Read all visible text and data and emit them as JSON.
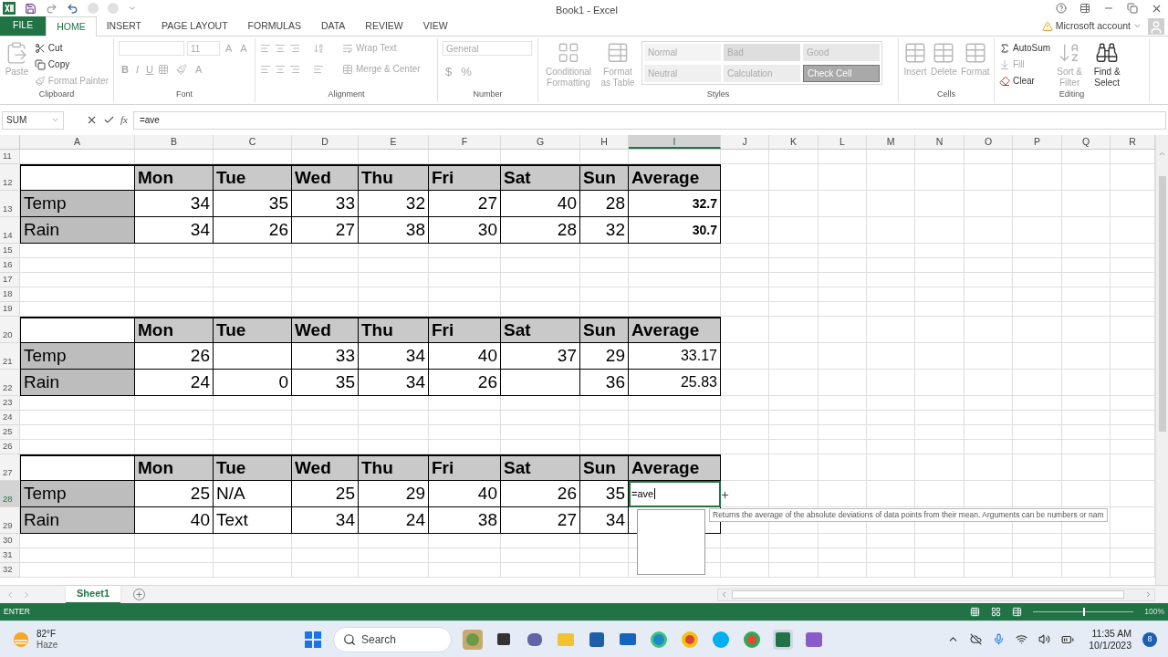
{
  "window": {
    "title": "Book1 - Excel"
  },
  "ribbon": {
    "tabs": [
      {
        "label": "FILE",
        "kind": "file",
        "selected": false
      },
      {
        "label": "HOME",
        "kind": "tab",
        "selected": true
      },
      {
        "label": "INSERT",
        "kind": "tab",
        "selected": false
      },
      {
        "label": "PAGE LAYOUT",
        "kind": "tab",
        "selected": false
      },
      {
        "label": "FORMULAS",
        "kind": "tab",
        "selected": false
      },
      {
        "label": "DATA",
        "kind": "tab",
        "selected": false
      },
      {
        "label": "REVIEW",
        "kind": "tab",
        "selected": false
      },
      {
        "label": "VIEW",
        "kind": "tab",
        "selected": false
      }
    ],
    "account": "Microsoft account",
    "groups": [
      {
        "kind": "clipboard",
        "name": "Clipboard",
        "buttons": [
          {
            "label": "Paste",
            "disabled": true
          },
          {
            "label": "Cut",
            "disabled": false
          },
          {
            "label": "Copy",
            "disabled": false
          },
          {
            "label": "Format Painter",
            "disabled": true
          }
        ]
      },
      {
        "kind": "font",
        "name": "Font",
        "buttons": [
          {
            "label": "11",
            "disabled": true
          },
          {
            "label": "A",
            "disabled": true
          },
          {
            "label": "A",
            "disabled": true
          },
          {
            "label": "B",
            "disabled": true
          },
          {
            "label": "I",
            "disabled": true
          },
          {
            "label": "U",
            "disabled": true
          },
          {
            "label": "A",
            "disabled": true
          }
        ]
      },
      {
        "kind": "alignment",
        "name": "Alignment",
        "buttons": [
          {
            "label": "Wrap Text",
            "disabled": true
          },
          {
            "label": "Merge & Center",
            "disabled": true
          }
        ]
      },
      {
        "kind": "number",
        "name": "Number",
        "buttons": [
          {
            "label": "General",
            "disabled": true
          },
          {
            "label": "$",
            "disabled": true
          },
          {
            "label": "%",
            "disabled": true
          }
        ]
      },
      {
        "kind": "styles",
        "name": "Styles",
        "buttons": [
          {
            "label": "Conditional Formatting",
            "disabled": true
          },
          {
            "label": "Format as Table",
            "disabled": true
          }
        ],
        "styles": [
          {
            "label": "Normal",
            "color": "#f4f4f4"
          },
          {
            "label": "Bad",
            "color": "#dedede"
          },
          {
            "label": "Good",
            "color": "#e8e8e8"
          },
          {
            "label": "Neutral",
            "color": "#f0f0f0"
          },
          {
            "label": "Calculation",
            "color": "#ececec"
          },
          {
            "label": "Check Cell",
            "color": "#a9a9a9"
          }
        ]
      },
      {
        "kind": "cells",
        "name": "Cells",
        "buttons": [
          {
            "label": "Insert",
            "disabled": true
          },
          {
            "label": "Delete",
            "disabled": true
          },
          {
            "label": "Format",
            "disabled": true
          }
        ]
      },
      {
        "kind": "editing",
        "name": "Editing",
        "buttons": [
          {
            "label": "AutoSum",
            "disabled": false
          },
          {
            "label": "Fill",
            "disabled": true
          },
          {
            "label": "Clear",
            "disabled": false
          },
          {
            "label": "Sort & Filter",
            "disabled": true
          },
          {
            "label": "Find & Select",
            "disabled": false
          }
        ]
      }
    ]
  },
  "formula_bar": {
    "name_box": "SUM",
    "function_label": "fx",
    "formula": "=ave"
  },
  "columns": [
    {
      "label": "A",
      "selected": false
    },
    {
      "label": "B",
      "selected": false
    },
    {
      "label": "C",
      "selected": false
    },
    {
      "label": "D",
      "selected": false
    },
    {
      "label": "E",
      "selected": false
    },
    {
      "label": "F",
      "selected": false
    },
    {
      "label": "G",
      "selected": false
    },
    {
      "label": "H",
      "selected": false
    },
    {
      "label": "I",
      "selected": true
    },
    {
      "label": "J",
      "selected": false
    },
    {
      "label": "K",
      "selected": false
    },
    {
      "label": "L",
      "selected": false
    },
    {
      "label": "M",
      "selected": false
    },
    {
      "label": "N",
      "selected": false
    },
    {
      "label": "O",
      "selected": false
    },
    {
      "label": "P",
      "selected": false
    },
    {
      "label": "Q",
      "selected": false
    },
    {
      "label": "R",
      "selected": false
    }
  ],
  "rows": [
    {
      "number": "11",
      "selected": false
    },
    {
      "number": "12",
      "selected": false,
      "cells": [
        {
          "kind": "blank"
        },
        {
          "kind": "header",
          "text": "Mon"
        },
        {
          "kind": "header",
          "text": "Tue"
        },
        {
          "kind": "header",
          "text": "Wed"
        },
        {
          "kind": "header",
          "text": "Thu"
        },
        {
          "kind": "header",
          "text": "Fri"
        },
        {
          "kind": "header",
          "text": "Sat"
        },
        {
          "kind": "header",
          "text": "Sun"
        },
        {
          "kind": "header",
          "text": "Average"
        }
      ]
    },
    {
      "number": "13",
      "selected": false,
      "cells": [
        {
          "kind": "label",
          "text": "Temp"
        },
        {
          "kind": "number",
          "text": "34"
        },
        {
          "kind": "number",
          "text": "35"
        },
        {
          "kind": "number",
          "text": "33"
        },
        {
          "kind": "number",
          "text": "32"
        },
        {
          "kind": "number",
          "text": "27"
        },
        {
          "kind": "number",
          "text": "40"
        },
        {
          "kind": "number",
          "text": "28"
        },
        {
          "kind": "average",
          "text": "32.7",
          "bold": true
        }
      ]
    },
    {
      "number": "14",
      "selected": false,
      "cells": [
        {
          "kind": "label",
          "text": "Rain"
        },
        {
          "kind": "number",
          "text": "34"
        },
        {
          "kind": "number",
          "text": "26"
        },
        {
          "kind": "number",
          "text": "27"
        },
        {
          "kind": "number",
          "text": "38"
        },
        {
          "kind": "number",
          "text": "30"
        },
        {
          "kind": "number",
          "text": "28"
        },
        {
          "kind": "number",
          "text": "32"
        },
        {
          "kind": "average",
          "text": "30.7",
          "bold": true
        }
      ]
    },
    {
      "number": "15",
      "selected": false
    },
    {
      "number": "16",
      "selected": false
    },
    {
      "number": "17",
      "selected": false
    },
    {
      "number": "18",
      "selected": false
    },
    {
      "number": "19",
      "selected": false
    },
    {
      "number": "20",
      "selected": false,
      "cells": [
        {
          "kind": "blank"
        },
        {
          "kind": "header",
          "text": "Mon"
        },
        {
          "kind": "header",
          "text": "Tue"
        },
        {
          "kind": "header",
          "text": "Wed"
        },
        {
          "kind": "header",
          "text": "Thu"
        },
        {
          "kind": "header",
          "text": "Fri"
        },
        {
          "kind": "header",
          "text": "Sat"
        },
        {
          "kind": "header",
          "text": "Sun"
        },
        {
          "kind": "header",
          "text": "Average"
        }
      ]
    },
    {
      "number": "21",
      "selected": false,
      "cells": [
        {
          "kind": "label",
          "text": "Temp"
        },
        {
          "kind": "number",
          "text": "26"
        },
        {
          "kind": "blank"
        },
        {
          "kind": "number",
          "text": "33"
        },
        {
          "kind": "number",
          "text": "34"
        },
        {
          "kind": "number",
          "text": "40"
        },
        {
          "kind": "number",
          "text": "37"
        },
        {
          "kind": "number",
          "text": "29"
        },
        {
          "kind": "average",
          "text": "33.17",
          "bold": false
        }
      ]
    },
    {
      "number": "22",
      "selected": false,
      "cells": [
        {
          "kind": "label",
          "text": "Rain"
        },
        {
          "kind": "number",
          "text": "24"
        },
        {
          "kind": "number",
          "text": "0"
        },
        {
          "kind": "number",
          "text": "35"
        },
        {
          "kind": "number",
          "text": "34"
        },
        {
          "kind": "number",
          "text": "26"
        },
        {
          "kind": "blank"
        },
        {
          "kind": "number",
          "text": "36"
        },
        {
          "kind": "average",
          "text": "25.83",
          "bold": false
        }
      ]
    },
    {
      "number": "23",
      "selected": false
    },
    {
      "number": "24",
      "selected": false
    },
    {
      "number": "25",
      "selected": false
    },
    {
      "number": "26",
      "selected": false
    },
    {
      "number": "27",
      "selected": false,
      "cells": [
        {
          "kind": "blank"
        },
        {
          "kind": "header",
          "text": "Mon"
        },
        {
          "kind": "header",
          "text": "Tue"
        },
        {
          "kind": "header",
          "text": "Wed"
        },
        {
          "kind": "header",
          "text": "Thu"
        },
        {
          "kind": "header",
          "text": "Fri"
        },
        {
          "kind": "header",
          "text": "Sat"
        },
        {
          "kind": "header",
          "text": "Sun"
        },
        {
          "kind": "header",
          "text": "Average"
        }
      ]
    },
    {
      "number": "28",
      "selected": true,
      "cells": [
        {
          "kind": "label",
          "text": "Temp"
        },
        {
          "kind": "number",
          "text": "25"
        },
        {
          "kind": "text",
          "text": "N/A"
        },
        {
          "kind": "number",
          "text": "25"
        },
        {
          "kind": "number",
          "text": "29"
        },
        {
          "kind": "number",
          "text": "40"
        },
        {
          "kind": "number",
          "text": "26"
        },
        {
          "kind": "number",
          "text": "35"
        },
        {
          "kind": "editing",
          "text": "=ave"
        }
      ]
    },
    {
      "number": "29",
      "selected": false,
      "cells": [
        {
          "kind": "label",
          "text": "Rain"
        },
        {
          "kind": "number",
          "text": "40"
        },
        {
          "kind": "text",
          "text": "Text"
        },
        {
          "kind": "number",
          "text": "34"
        },
        {
          "kind": "number",
          "text": "24"
        },
        {
          "kind": "number",
          "text": "38"
        },
        {
          "kind": "number",
          "text": "27"
        },
        {
          "kind": "number",
          "text": "34"
        },
        {
          "kind": "blank"
        }
      ]
    },
    {
      "number": "30",
      "selected": false
    },
    {
      "number": "31",
      "selected": false
    },
    {
      "number": "32",
      "selected": false
    }
  ],
  "autocomplete": {
    "tooltip": "Returns the average of the absolute deviations of data points from their mean. Arguments can be numbers or nam"
  },
  "sheet_tabs": [
    {
      "label": "Sheet1",
      "selected": true
    }
  ],
  "status_bar": {
    "mode": "ENTER",
    "zoom": "100%",
    "level": 0.5
  },
  "taskbar": {
    "temperature": "82°F",
    "weather": "Haze",
    "search_placeholder": "Search",
    "time": "11:35 AM",
    "date": "10/1/2023",
    "notifications": "8"
  }
}
